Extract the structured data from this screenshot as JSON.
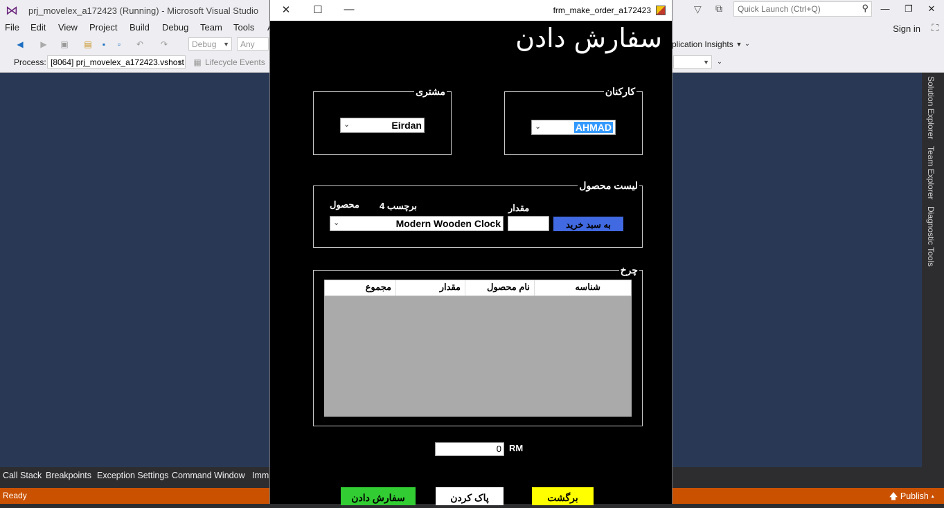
{
  "vs": {
    "title": "prj_movelex_a172423 (Running) - Microsoft Visual Studio",
    "quick_launch_placeholder": "Quick Launch (Ctrl+Q)",
    "menu": [
      "File",
      "Edit",
      "View",
      "Project",
      "Build",
      "Debug",
      "Team",
      "Tools",
      "A"
    ],
    "sign_in": "Sign in",
    "config": "Debug",
    "platform": "Any CPU",
    "app_insights": "plication Insights",
    "process_label": "Process:",
    "process_value": "[8064] prj_movelex_a172423.vshost",
    "lifecycle": "Lifecycle Events",
    "side_tabs": [
      "Solution Explorer",
      "Team Explorer",
      "Diagnostic Tools"
    ],
    "bottom_tabs": [
      "Call Stack",
      "Breakpoints",
      "Exception Settings",
      "Command Window",
      "Imm"
    ],
    "status": "Ready",
    "publish": "Publish"
  },
  "form": {
    "caption": "frm_make_order_a172423",
    "heading": "سفارش دادن",
    "customer_group": "مشتری",
    "customer_value": "Eirdan",
    "staff_group": "کارکنان",
    "staff_value": "AHMAD",
    "product_list_group": "لیست محصول",
    "product_label": "محصول",
    "tag_label": "برچسب 4",
    "quantity_label": "مقدار",
    "product_value": "Modern Wooden  Clock",
    "quantity_value": "",
    "add_to_cart": "به سبد خرید",
    "cart_group": "چرخ",
    "grid_columns": [
      "شناسه",
      "نام محصول",
      "مقدار",
      "مجموع"
    ],
    "total_value": "0",
    "currency": "RM",
    "order_button": "سفارش دادن",
    "clear_button": "پاک کردن",
    "back_button": "برگشت"
  },
  "colors": {
    "vs_status": "#ca5100",
    "add_button": "#4169e1",
    "order_button": "#32cd32",
    "back_button": "#ffff00"
  }
}
